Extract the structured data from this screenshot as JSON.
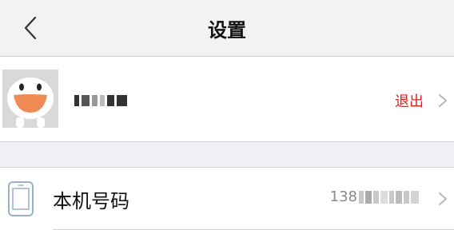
{
  "navbar": {
    "title": "设置",
    "back_icon": "chevron-left-icon"
  },
  "account": {
    "name": "",
    "logout_label": "退出",
    "chevron_icon": "chevron-right-icon",
    "logout_color": "#e02020"
  },
  "phone": {
    "label": "本机号码",
    "value_prefix": "138",
    "icon": "smartphone-icon",
    "chevron_icon": "chevron-right-icon"
  }
}
